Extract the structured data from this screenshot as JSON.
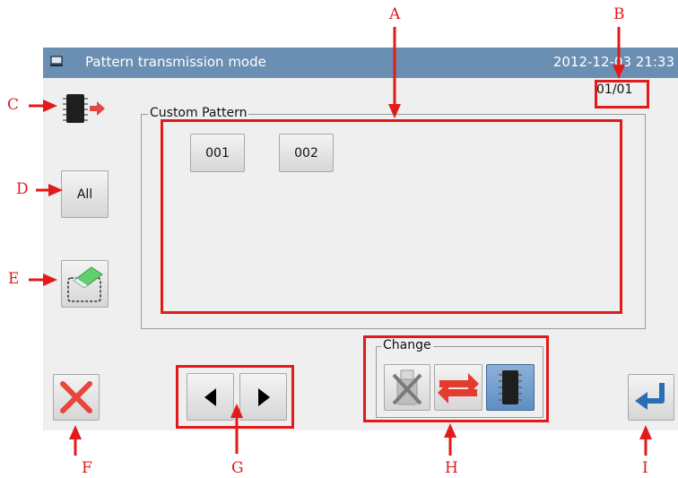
{
  "header": {
    "title": "Pattern transmission mode",
    "datetime": "2012-12-03  21:33"
  },
  "page_indicator": "01/01",
  "custom_pattern": {
    "label": "Custom Pattern",
    "items": [
      {
        "label": "001"
      },
      {
        "label": "002"
      }
    ]
  },
  "side_buttons": {
    "all_label": "All"
  },
  "change": {
    "label": "Change"
  },
  "callouts": {
    "A": "A",
    "B": "B",
    "C": "C",
    "D": "D",
    "E": "E",
    "F": "F",
    "G": "G",
    "H": "H",
    "I": "I"
  },
  "colors": {
    "titlebar": "#6b8fb3",
    "screen_bg": "#efefef",
    "annotation": "#e21a1a",
    "accent_blue": "#2a6fb5"
  }
}
